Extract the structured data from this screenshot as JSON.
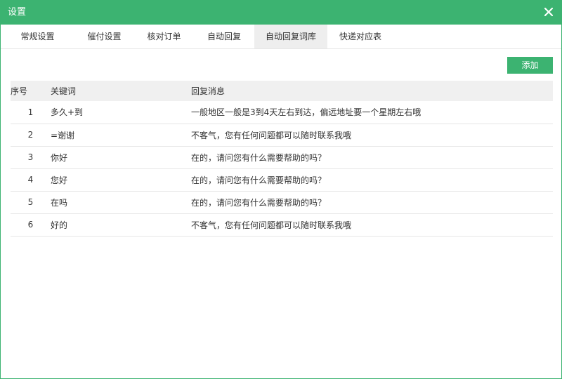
{
  "window": {
    "title": "设置",
    "close_icon": "close-icon",
    "accent_color": "#3cb371"
  },
  "tabs": [
    {
      "label": "常规设置",
      "active": false
    },
    {
      "label": "催付设置",
      "active": false
    },
    {
      "label": "核对订单",
      "active": false
    },
    {
      "label": "自动回复",
      "active": false
    },
    {
      "label": "自动回复词库",
      "active": true
    },
    {
      "label": "快递对应表",
      "active": false
    }
  ],
  "toolbar": {
    "add_label": "添加"
  },
  "table": {
    "headers": {
      "index": "序号",
      "keyword": "关键词",
      "reply": "回复消息"
    },
    "rows": [
      {
        "index": "1",
        "keyword": "多久+到",
        "reply": "一般地区一般是3到4天左右到达，偏远地址要一个星期左右哦"
      },
      {
        "index": "2",
        "keyword": "=谢谢",
        "reply": "不客气，您有任何问题都可以随时联系我哦"
      },
      {
        "index": "3",
        "keyword": "你好",
        "reply": "在的，请问您有什么需要帮助的吗？"
      },
      {
        "index": "4",
        "keyword": "您好",
        "reply": "在的，请问您有什么需要帮助的吗？"
      },
      {
        "index": "5",
        "keyword": "在吗",
        "reply": "在的，请问您有什么需要帮助的吗？"
      },
      {
        "index": "6",
        "keyword": "好的",
        "reply": "不客气，您有任何问题都可以随时联系我哦"
      }
    ]
  }
}
